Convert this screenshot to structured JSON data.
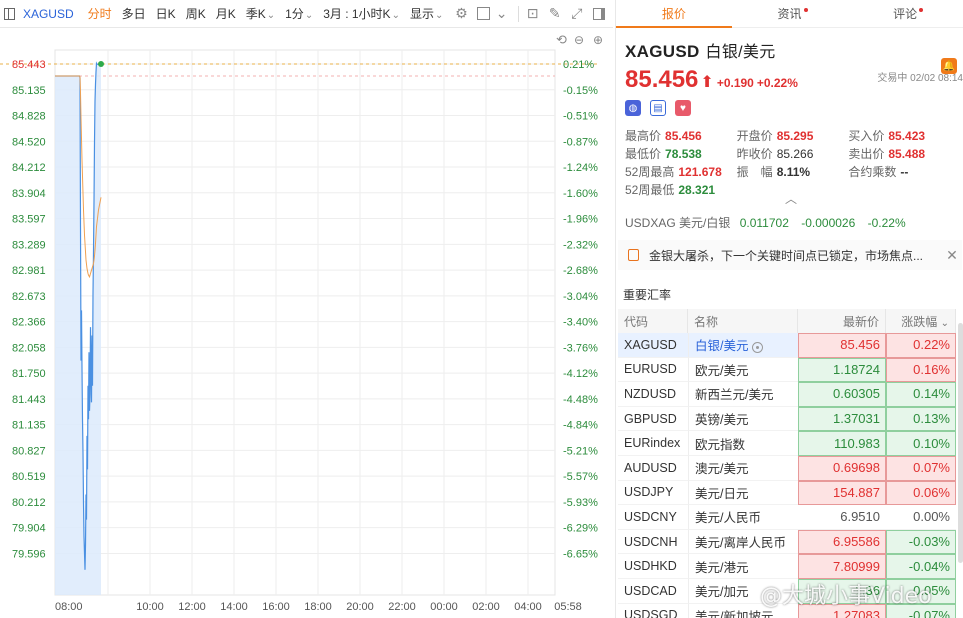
{
  "toolbar": {
    "symbol": "XAGUSD",
    "items": [
      "分时",
      "多日",
      "日K",
      "周K",
      "月K",
      "季K",
      "1分",
      "3月 : 1小时K",
      "显示"
    ],
    "active": "分时"
  },
  "chart_data": {
    "type": "line",
    "title": "",
    "y_ticks": [
      "85.443",
      "85.135",
      "84.828",
      "84.520",
      "84.212",
      "83.904",
      "83.597",
      "83.289",
      "82.981",
      "82.673",
      "82.366",
      "82.058",
      "81.750",
      "81.443",
      "81.135",
      "80.827",
      "80.519",
      "80.212",
      "79.904",
      "79.596"
    ],
    "y_pct_ticks": [
      "0.21%",
      "-0.15%",
      "-0.51%",
      "-0.87%",
      "-1.24%",
      "-1.60%",
      "-1.96%",
      "-2.32%",
      "-2.68%",
      "-3.04%",
      "-3.40%",
      "-3.76%",
      "-4.12%",
      "-4.48%",
      "-4.84%",
      "-5.21%",
      "-5.57%",
      "-5.93%",
      "-6.29%",
      "-6.65%"
    ],
    "x_ticks": [
      "10:00",
      "12:00",
      "14:00",
      "16:00",
      "18:00",
      "20:00",
      "22:00",
      "00:00",
      "02:00",
      "04:00",
      "05:58"
    ],
    "x_first_label": "08:00",
    "ylim": [
      79.35,
      85.6
    ],
    "current_price": 85.443,
    "price_series": {
      "minute": [
        0,
        2,
        3,
        4,
        5,
        5.5,
        6,
        6.5,
        7,
        7.5,
        8,
        8.5,
        9,
        9.5,
        10,
        10.5,
        11,
        11.5,
        12,
        12.5,
        13,
        13.5,
        14,
        14.5,
        15,
        15.5,
        16,
        16.5,
        17,
        17.5,
        18,
        18.5,
        19,
        19.5,
        20,
        20.5,
        21,
        21.5,
        22,
        22.5,
        23,
        23.5,
        24,
        24.5,
        25,
        25.5,
        26,
        26.5,
        27,
        27.5,
        28,
        28.5,
        29,
        29.5,
        30,
        30.5,
        31,
        31.5,
        32,
        32.5,
        33,
        33.5,
        34,
        34.5,
        35,
        35.5,
        36,
        36.5,
        37,
        37.5,
        38,
        38.5,
        39,
        39.5,
        40,
        40.5,
        41,
        41.5,
        42,
        42.5,
        43,
        43.5,
        44,
        44.5,
        45,
        45.5,
        46
      ],
      "price": [
        85.3,
        85.3,
        85.3,
        85.3,
        85.3,
        85.3,
        85.3,
        85.3,
        85.3,
        85.3,
        85.3,
        85.3,
        85.3,
        85.3,
        85.3,
        85.3,
        85.3,
        85.3,
        85.3,
        85.3,
        85.3,
        85.3,
        85.3,
        85.3,
        85.3,
        85.3,
        85.3,
        85.3,
        85.3,
        85.3,
        85.3,
        85.3,
        85.3,
        85.3,
        85.3,
        85.3,
        85.3,
        85.3,
        85.3,
        85.3,
        85.3,
        85.3,
        85.3,
        85.3,
        85.28,
        83.5,
        81.9,
        82.5,
        81.8,
        81.2,
        80.8,
        80.2,
        79.8,
        79.6,
        79.4,
        79.7,
        80.3,
        80.0,
        81.0,
        80.6,
        81.6,
        81.2,
        82.0,
        81.3,
        81.5,
        82.3,
        81.8,
        81.4,
        82.2,
        81.6,
        82.7,
        83.2,
        83.8,
        84.5,
        85.0,
        85.2,
        85.35,
        85.45,
        85.44,
        85.44,
        85.44,
        85.44,
        85.44,
        85.44,
        85.44,
        85.44,
        85.44
      ],
      "avg": [
        85.3,
        85.3,
        85.3,
        85.3,
        85.3,
        85.3,
        85.3,
        85.3,
        85.3,
        85.3,
        85.3,
        85.3,
        85.3,
        85.3,
        85.3,
        85.3,
        85.3,
        85.3,
        85.3,
        85.3,
        85.3,
        85.3,
        85.3,
        85.3,
        85.3,
        85.3,
        85.3,
        85.3,
        85.3,
        85.3,
        85.3,
        85.3,
        85.3,
        85.3,
        85.3,
        85.3,
        85.3,
        85.3,
        85.3,
        85.3,
        85.3,
        85.3,
        85.3,
        85.3,
        85.29,
        85.1,
        84.8,
        84.55,
        84.3,
        84.1,
        83.9,
        83.7,
        83.55,
        83.4,
        83.3,
        83.2,
        83.1,
        83.05,
        83.0,
        82.97,
        82.94,
        82.92,
        82.91,
        82.9,
        82.92,
        82.94,
        82.96,
        82.98,
        83.0,
        83.02,
        83.04,
        83.06,
        83.1,
        83.15,
        83.22,
        83.3,
        83.4,
        83.5,
        83.55,
        83.6,
        83.65,
        83.7,
        83.73,
        83.76,
        83.79,
        83.82,
        83.85
      ]
    },
    "series": [
      {
        "name": "price",
        "color": "#4a90e2"
      },
      {
        "name": "avg",
        "color": "#f0a050"
      }
    ],
    "grid": true
  },
  "panel": {
    "tabs": [
      {
        "label": "报价",
        "active": true,
        "dot": false
      },
      {
        "label": "资讯",
        "active": false,
        "dot": true
      },
      {
        "label": "评论",
        "active": false,
        "dot": true
      }
    ],
    "symbol": "XAGUSD",
    "name": "白银/美元",
    "price": "85.456",
    "change": "+0.190",
    "change_pct": "+0.22%",
    "trade_time": "交易中 02/02 08:14",
    "stats": [
      [
        {
          "label": "最高价",
          "value": "85.456",
          "color": "red"
        },
        {
          "label": "开盘价",
          "value": "85.295",
          "color": "red"
        },
        {
          "label": "买入价",
          "value": "85.423",
          "color": "red"
        }
      ],
      [
        {
          "label": "最低价",
          "value": "78.538",
          "color": "green"
        },
        {
          "label": "昨收价",
          "value": "85.266",
          "color": "dark"
        },
        {
          "label": "卖出价",
          "value": "85.488",
          "color": "red"
        }
      ],
      [
        {
          "label": "52周最高",
          "value": "121.678",
          "color": "red"
        },
        {
          "label": "振　幅",
          "value": "8.11%",
          "color": "dark"
        },
        {
          "label": "合约乘数",
          "value": "--",
          "color": "dark"
        }
      ],
      [
        {
          "label": "52周最低",
          "value": "28.321",
          "color": "green"
        }
      ]
    ],
    "usd_row": {
      "name": "USDXAG 美元/白银",
      "price": "0.011702",
      "change": "-0.000026",
      "pct": "-0.22%"
    },
    "news": "金银大屠杀，下一个关键时间点已锁定，市场焦点...",
    "rates_title": "重要汇率",
    "rates_headers": {
      "code": "代码",
      "name": "名称",
      "price": "最新价",
      "pct": "涨跌幅"
    },
    "rates": [
      {
        "code": "XAGUSD",
        "name": "白银/美元",
        "price": "85.456",
        "pct": "0.22%",
        "dir": "up",
        "selected": true
      },
      {
        "code": "EURUSD",
        "name": "欧元/美元",
        "price": "1.18724",
        "pct": "0.16%",
        "dir": "down",
        "pdir": "up"
      },
      {
        "code": "NZDUSD",
        "name": "新西兰元/美元",
        "price": "0.60305",
        "pct": "0.14%",
        "dir": "down",
        "pdir": "down"
      },
      {
        "code": "GBPUSD",
        "name": "英镑/美元",
        "price": "1.37031",
        "pct": "0.13%",
        "dir": "down",
        "pdir": "down"
      },
      {
        "code": "EURindex",
        "name": "欧元指数",
        "price": "110.983",
        "pct": "0.10%",
        "dir": "down",
        "pdir": "down"
      },
      {
        "code": "AUDUSD",
        "name": "澳元/美元",
        "price": "0.69698",
        "pct": "0.07%",
        "dir": "up",
        "pdir": "up"
      },
      {
        "code": "USDJPY",
        "name": "美元/日元",
        "price": "154.887",
        "pct": "0.06%",
        "dir": "up",
        "pdir": "up"
      },
      {
        "code": "USDCNY",
        "name": "美元/人民币",
        "price": "6.9510",
        "pct": "0.00%",
        "dir": "flat",
        "pdir": "flat"
      },
      {
        "code": "USDCNH",
        "name": "美元/离岸人民币",
        "price": "6.95586",
        "pct": "-0.03%",
        "dir": "up",
        "pdir": "down"
      },
      {
        "code": "USDHKD",
        "name": "美元/港元",
        "price": "7.80999",
        "pct": "-0.04%",
        "dir": "up",
        "pdir": "down"
      },
      {
        "code": "USDCAD",
        "name": "美元/加元",
        "price": "1.36",
        "pct": "-0.05%",
        "dir": "down",
        "pdir": "down"
      },
      {
        "code": "USDSGD",
        "name": "美元/新加坡元",
        "price": "1.27083",
        "pct": "-0.07%",
        "dir": "up",
        "pdir": "down"
      }
    ],
    "watermark": "@大城小事Video"
  },
  "colors": {
    "up": "#e03131",
    "down": "#2c8c3c",
    "accent": "#f07a1a",
    "link": "#2a63d9"
  }
}
